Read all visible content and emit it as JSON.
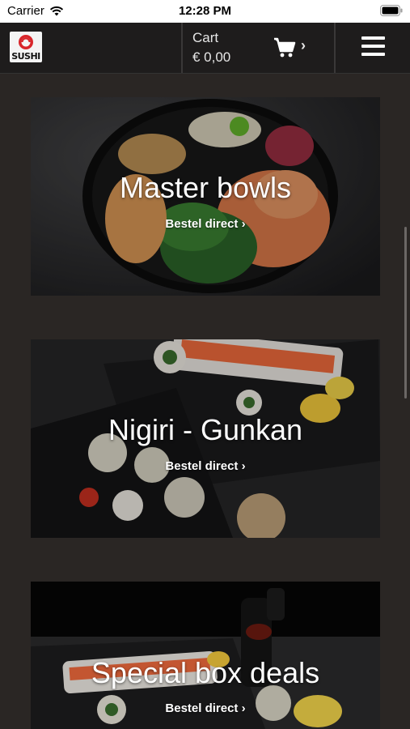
{
  "status": {
    "carrier": "Carrier",
    "time": "12:28 PM"
  },
  "header": {
    "logo_text": "SUSHI",
    "cart_label": "Cart",
    "cart_total": "€ 0,00",
    "chevron": "›"
  },
  "categories": [
    {
      "title": "Master bowls",
      "cta": "Bestel direct ›"
    },
    {
      "title": "Nigiri - Gunkan",
      "cta": "Bestel direct ›"
    },
    {
      "title": "Special box deals",
      "cta": "Bestel direct ›"
    }
  ],
  "icons": {
    "cart": "cart-icon",
    "menu": "hamburger-menu-icon",
    "wifi": "wifi-icon",
    "battery": "battery-icon"
  },
  "colors": {
    "background": "#2a2624",
    "header": "#1e1c1c",
    "text": "#ffffff"
  }
}
